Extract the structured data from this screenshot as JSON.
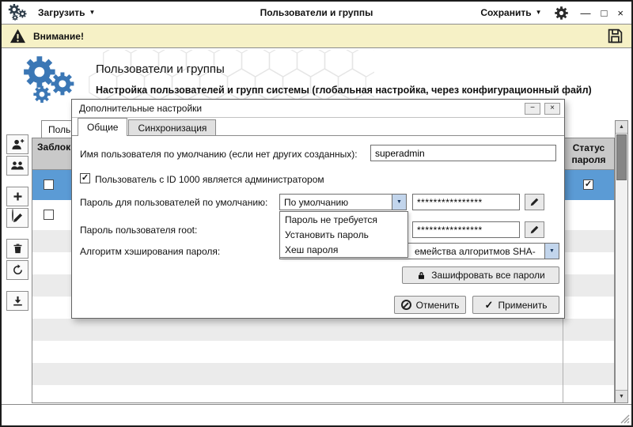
{
  "icons": {
    "caret_down": "▼",
    "check": "✓",
    "minimize": "—",
    "maximize": "□",
    "close": "×",
    "dialog_minimize": "−",
    "dialog_close": "×",
    "scroll_up": "▲",
    "scroll_down": "▼"
  },
  "colors": {
    "selected_row": "#5b9bd5",
    "warning_bar": "#f6f1c6",
    "hero_gears": "#3b77b5"
  },
  "titlebar": {
    "load_label": "Загрузить",
    "title": "Пользователи и группы",
    "save_label": "Сохранить"
  },
  "warning_bar": {
    "label": "Внимание!"
  },
  "hero": {
    "title": "Пользователи и группы",
    "subtitle": "Настройка пользователей и групп системы (глобальная настройка, через конфигурационный файл)"
  },
  "users_table": {
    "tab_label": "Поль",
    "columns": {
      "blocked": "Заблок",
      "password_status": "Статус пароля"
    },
    "rows": [
      {
        "selected": true,
        "blocked_checkbox": false,
        "password_status_checkbox": true
      },
      {
        "selected": false,
        "blocked_checkbox": false,
        "password_status_radio": true
      }
    ]
  },
  "dialog": {
    "title": "Дополнительные настройки",
    "tabs": [
      {
        "label": "Общие",
        "active": true
      },
      {
        "label": "Синхронизация",
        "active": false
      }
    ],
    "default_username": {
      "label": "Имя пользователя по умолчанию (если нет других созданных):",
      "value": "superadmin"
    },
    "admin_checkbox": {
      "label": "Пользователь с ID 1000 является администратором",
      "checked": true
    },
    "default_password": {
      "label": "Пароль для пользователей по умолчанию:",
      "selected_option": "По умолчанию",
      "mask": "****************"
    },
    "password_dropdown": {
      "open": true,
      "options": [
        "Пароль не требуется",
        "Установить пароль",
        "Хеш пароля"
      ]
    },
    "root_password": {
      "label": "Пароль пользователя root:",
      "mask": "****************"
    },
    "hash_algorithm": {
      "label": "Алгоритм хэширования пароля:",
      "visible_value": "емейства алгоритмов SHA-"
    },
    "encrypt_all_label": "Зашифровать все пароли",
    "cancel_label": "Отменить",
    "apply_label": "Применить"
  }
}
